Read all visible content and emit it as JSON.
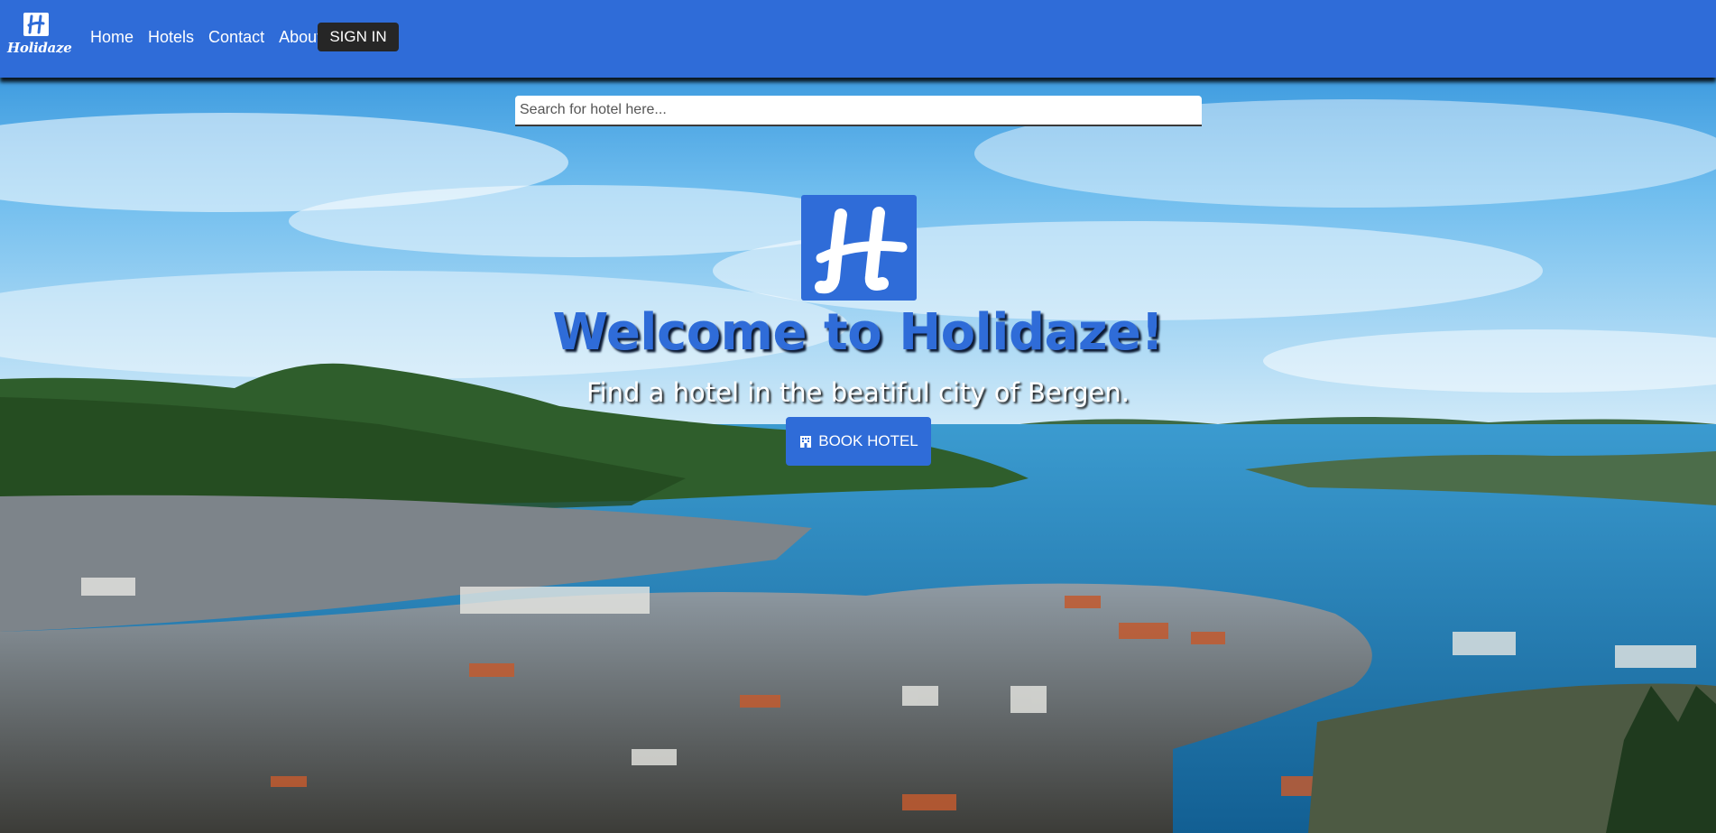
{
  "nav": {
    "brand": "Holidaze",
    "links": [
      "Home",
      "Hotels",
      "Contact",
      "About"
    ],
    "sign_in_label": "SIGN IN"
  },
  "search": {
    "placeholder": "Search for hotel here...",
    "value": ""
  },
  "hero": {
    "title": "Welcome to Holidaze!",
    "subtitle": "Find a hotel in the beatiful city of Bergen.",
    "book_label": "BOOK HOTEL",
    "book_icon": "hotel-icon"
  },
  "colors": {
    "brand_blue": "#2f6cd8",
    "sign_in_dark": "#262626",
    "sky": "#3a9be0",
    "water": "#1b7fbf"
  }
}
